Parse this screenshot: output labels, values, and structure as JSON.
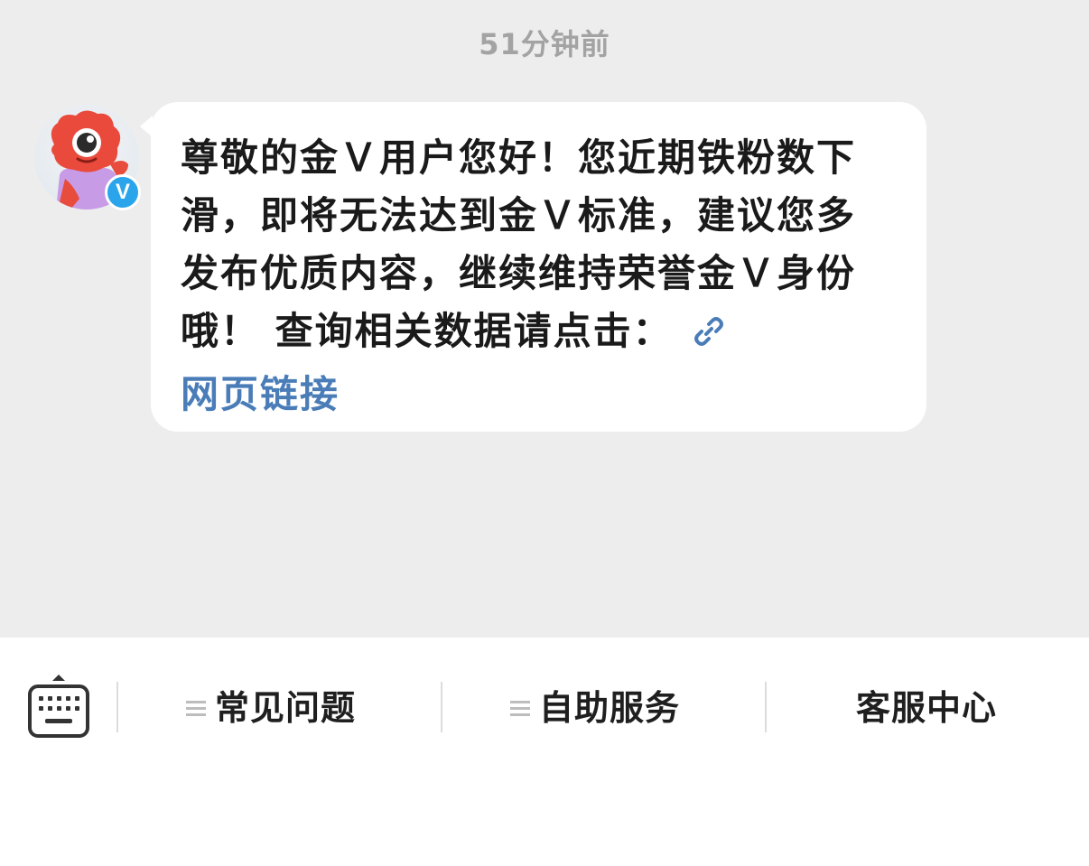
{
  "chat": {
    "timestamp": "51分钟前",
    "message": {
      "text": "尊敬的金Ｖ用户您好！您近期铁粉数下滑，即将无法达到金Ｖ标准，建议您多发布优质内容，继续维持荣誉金Ｖ身份哦！ 查询相关数据请点击：",
      "link_label": "网页链接",
      "link_icon": "link-icon"
    },
    "sender": {
      "avatar_icon": "weibo-mascot-avatar",
      "badge_label": "V",
      "badge_color": "#2aa5ec"
    }
  },
  "toolbar": {
    "keyboard_icon": "keyboard-icon",
    "items": [
      {
        "label": "常见问题",
        "icon": "menu-icon"
      },
      {
        "label": "自助服务",
        "icon": "menu-icon"
      },
      {
        "label": "客服中心"
      }
    ]
  },
  "colors": {
    "chat_background": "#ededed",
    "bubble_background": "#ffffff",
    "link": "#4a7db8",
    "badge": "#2aa5ec"
  }
}
